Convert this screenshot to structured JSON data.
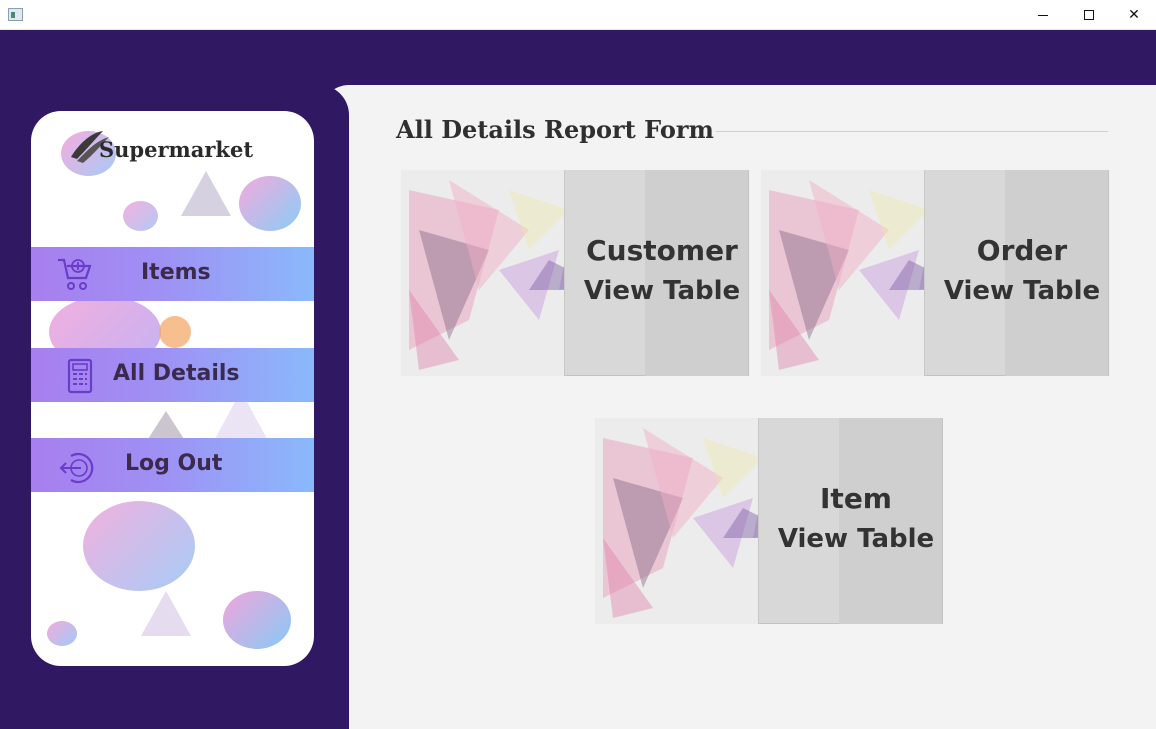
{
  "window": {
    "icon": "app-window-icon",
    "controls": {
      "minimize": "minimize-icon",
      "maximize": "maximize-icon",
      "close": "✕"
    }
  },
  "sidebar": {
    "brand": "Supermarket",
    "items": [
      {
        "label": "Items",
        "icon": "cart-icon"
      },
      {
        "label": "All Details",
        "icon": "calculator-icon"
      },
      {
        "label": "Log Out",
        "icon": "logout-icon"
      }
    ]
  },
  "main": {
    "title": "All Details Report Form",
    "cards": [
      {
        "line1": "Customer",
        "line2": "View Table"
      },
      {
        "line1": "Order",
        "line2": "View Table"
      },
      {
        "line1": "Item",
        "line2": "View Table"
      }
    ]
  },
  "colors": {
    "header": "#311863",
    "content_bg": "#f3f3f3",
    "nav_gradient_start": "#a77fee",
    "nav_gradient_end": "#8ab9fb",
    "card_bg": "#ececec",
    "card_panel": "#d8d8d8"
  }
}
